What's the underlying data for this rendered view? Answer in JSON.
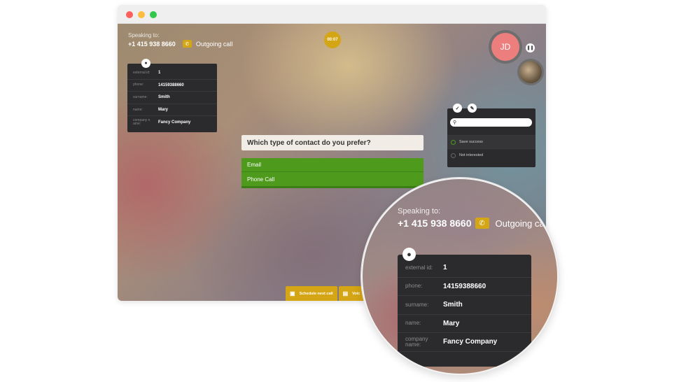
{
  "call": {
    "speaking_label": "Speaking to:",
    "phone_number": "+1 415 938 8660",
    "call_type": "Outgoing call",
    "timer": "00:07",
    "agent_initials": "JD"
  },
  "contact": {
    "fields": [
      {
        "key": "external id:",
        "value": "1"
      },
      {
        "key": "phone:",
        "value": "14159388660"
      },
      {
        "key": "surname:",
        "value": "Smith"
      },
      {
        "key": "name:",
        "value": "Mary"
      },
      {
        "key": "company n ame:",
        "value": "Fancy Company"
      }
    ]
  },
  "script": {
    "question": "Which type of contact do you prefer?",
    "options": [
      "Email",
      "Phone Call"
    ]
  },
  "status_panel": {
    "search_placeholder": "",
    "items": [
      "Save success",
      "Not interested"
    ]
  },
  "bottom_actions": {
    "schedule": "Schedule next call",
    "voice_partial": "Voic"
  },
  "zoom": {
    "speaking_label": "Speaking to:",
    "phone_number": "+1 415 938 8660",
    "call_type": "Outgoing call",
    "fields": [
      {
        "key": "external id:",
        "value": "1"
      },
      {
        "key": "phone:",
        "value": "14159388660"
      },
      {
        "key": "surname:",
        "value": "Smith"
      },
      {
        "key": "name:",
        "value": "Mary"
      },
      {
        "key": "company name:",
        "value": "Fancy Company"
      }
    ]
  },
  "colors": {
    "accent": "#d4a514",
    "option_green": "#4e9a1d",
    "panel_dark": "#2b2b2e",
    "avatar_pink": "#ec7e7e"
  }
}
